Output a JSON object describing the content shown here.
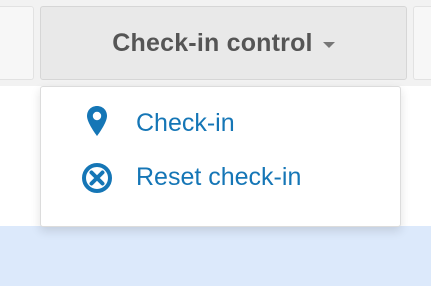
{
  "toolbar": {
    "checkin_control_label": "Check-in control"
  },
  "dropdown": {
    "items": [
      {
        "label": "Check-in",
        "icon": "map-marker-icon"
      },
      {
        "label": "Reset check-in",
        "icon": "times-circle-icon"
      }
    ]
  },
  "colors": {
    "link": "#1576b6",
    "button_bg": "#e9e9e9",
    "button_text": "#555555",
    "info_band": "#dce9fb"
  }
}
